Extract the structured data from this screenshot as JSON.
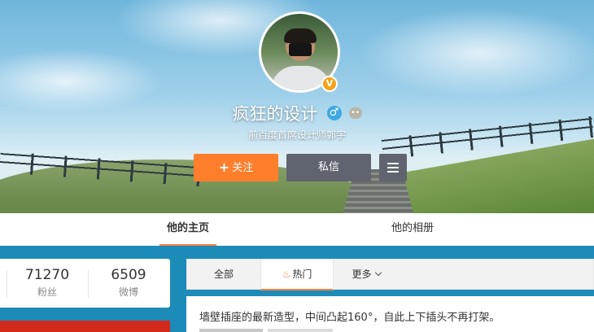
{
  "profile": {
    "nickname": "疯狂的设计",
    "gender_icon": "male-icon",
    "gender_symbol": "♂",
    "level_icon": "level-badge-icon",
    "level_symbol": "••",
    "verified_icon": "verified-badge-icon",
    "verified_symbol": "V",
    "intro": "前百度首席设计师郭宇"
  },
  "actions": {
    "follow_label": "关注",
    "follow_plus": "+",
    "message_label": "私信",
    "more_icon": "menu-icon"
  },
  "tabs": [
    {
      "label": "他的主页",
      "active": true
    },
    {
      "label": "他的相册",
      "active": false
    }
  ],
  "stats": {
    "fans_count": "71270",
    "fans_label": "粉丝",
    "weibo_count": "6509",
    "weibo_label": "微博"
  },
  "feed_tabs": {
    "all_label": "全部",
    "hot_label": "热门",
    "hot_icon": "fire-icon",
    "hot_symbol": "♨",
    "more_label": "更多"
  },
  "post": {
    "text": "墙壁插座的最新造型，中间凸起160°，自此上下插头不再打架。"
  },
  "colors": {
    "accent": "#ff8140",
    "follow_button": "#ff7e2c",
    "secondary_button": "#5f6470",
    "page_background": "#1d8bb7"
  }
}
